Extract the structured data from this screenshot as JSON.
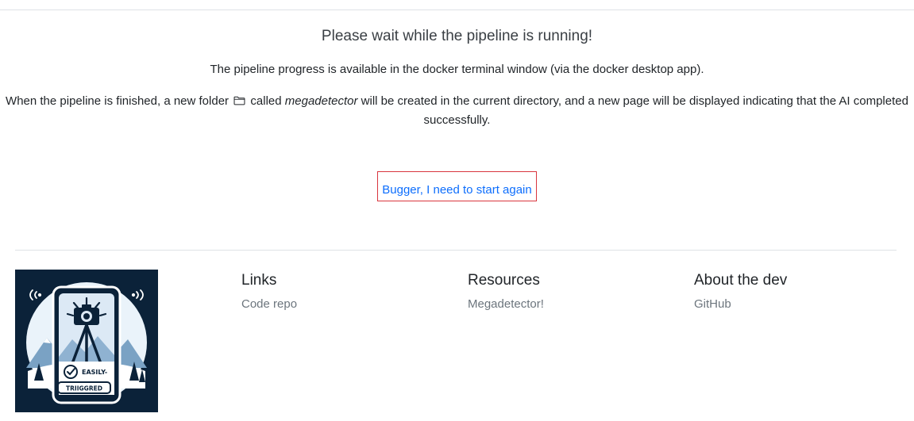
{
  "main": {
    "title": "Please wait while the pipeline is running!",
    "paragraph_1": "The pipeline progress is available in the docker terminal window (via the docker desktop app).",
    "paragraph_2_before": "When the pipeline is finished, a new folder",
    "paragraph_2_called": "called",
    "paragraph_2_folder_name": "megadetector",
    "paragraph_2_after": "will be created in the current directory, and a new page will be displayed indicating that the AI completed successfully.",
    "restart_button": "Bugger, I need to start again"
  },
  "footer": {
    "logo": {
      "top_text": "EASILY-",
      "bottom_text": "TRIIGGRED"
    },
    "columns": [
      {
        "heading": "Links",
        "link": "Code repo"
      },
      {
        "heading": "Resources",
        "link": "Megadetector!"
      },
      {
        "heading": "About the dev",
        "link": "GitHub"
      }
    ]
  },
  "icons": {
    "folder": "folder-icon",
    "logo": "camera-trap-logo-icon"
  },
  "colors": {
    "link": "#0d6efd",
    "button_border": "#d9363e",
    "muted_link": "#6c757d",
    "logo_background": "#0b2239"
  }
}
